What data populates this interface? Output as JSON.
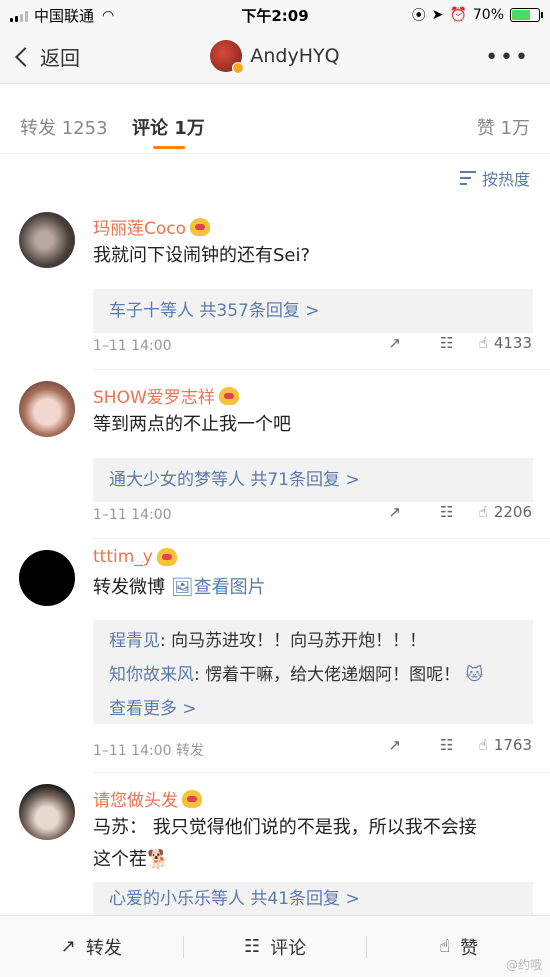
{
  "status_bar": {
    "carrier": "中国联通",
    "time": "下午2:09",
    "battery": "70%",
    "battery_level": 0.7
  },
  "nav": {
    "back_label": "返回",
    "title": "AndyHYQ"
  },
  "tabs": {
    "repost": "转发 1253",
    "comment": "评论 1万",
    "like": "赞 1万"
  },
  "sort_label": "按热度",
  "comments": [
    {
      "name": "玛丽莲Coco",
      "text": "我就问下设闹钟的还有Sei?",
      "replies_summary": "车子十等人  共357条回复 >",
      "time": "1–11 14:00",
      "likes": "4133"
    },
    {
      "name": "SHOW爱罗志祥",
      "text": "等到两点的不止我一个吧",
      "replies_summary": "通大少女的梦等人  共71条回复 >",
      "time": "1–11 14:00",
      "likes": "2206"
    },
    {
      "name": "tttim_y",
      "text": "转发微博",
      "image_link": "查看图片",
      "reply1_name": "程青见",
      "reply1_text": ": 向马苏进攻！！向马苏开炮！！！",
      "reply2_name": "知你故来风",
      "reply2_text": ": 愣着干嘛，给大佬递烟阿！图呢！",
      "more": "查看更多 >",
      "time": "1–11 14:00",
      "via": "转发",
      "likes": "1763"
    },
    {
      "name": "请您做头发",
      "text_line1": "马苏：  我只觉得他们说的不是我，所以我不会接",
      "text_line2": "这个茬",
      "replies_summary": "心爱的小乐乐等人  共41条回复 >"
    }
  ],
  "bottom_bar": {
    "repost": "转发",
    "comment": "评论",
    "like": "赞"
  },
  "watermark": "@约哦"
}
